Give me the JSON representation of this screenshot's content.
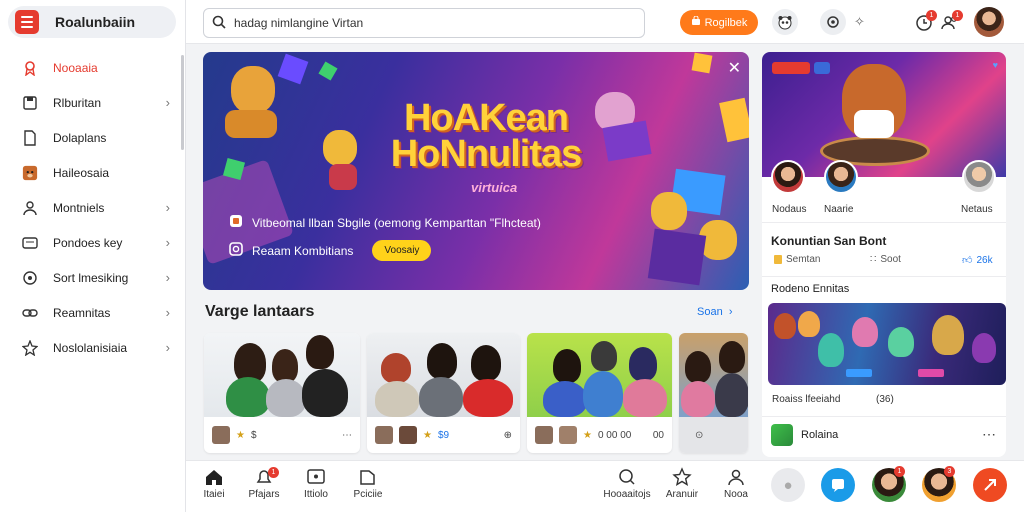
{
  "sidebar": {
    "brand": "Roalunbaiin",
    "items": [
      {
        "label": "Nooaaia",
        "icon": "ribbon-icon",
        "active": true,
        "chevron": false
      },
      {
        "label": "Rlburitan",
        "icon": "save-icon",
        "active": false,
        "chevron": true
      },
      {
        "label": "Dolaplans",
        "icon": "document-icon",
        "active": false,
        "chevron": false
      },
      {
        "label": "Haileosaia",
        "icon": "bear-icon",
        "active": false,
        "chevron": false
      },
      {
        "label": "Montniels",
        "icon": "user-icon",
        "active": false,
        "chevron": true
      },
      {
        "label": "Pondoes key",
        "icon": "card-icon",
        "active": false,
        "chevron": true
      },
      {
        "label": "Sort lmesiking",
        "icon": "globe-icon",
        "active": false,
        "chevron": true
      },
      {
        "label": "Reamnitas",
        "icon": "link-icon",
        "active": false,
        "chevron": true
      },
      {
        "label": "Noslolanisiaia",
        "icon": "star-icon",
        "active": false,
        "chevron": true
      }
    ]
  },
  "topbar": {
    "search_value": "hadag nimlangine Virtan",
    "primary_button": "Rogilbek",
    "notif_badge_1": "1",
    "notif_badge_2": "1"
  },
  "hero": {
    "title_line1": "HoAKean",
    "title_line2": "HoNnulitas",
    "subtitle": "virtuica",
    "description": "Vitbeomal llban Sbgile (oemong Kemparttan \"Flhcteat)",
    "cta_label": "Reaam Kombitians",
    "cta_button": "Voosaiy"
  },
  "section": {
    "title": "Varge lantaars",
    "see_all": "Soan"
  },
  "cards": [
    {
      "meta_text": "$",
      "menu": "⋯"
    },
    {
      "meta_text": "$9",
      "menu": "⊕"
    },
    {
      "meta_text": "0 00 00",
      "menu": "00"
    },
    {
      "meta_text": "",
      "menu": "⊙"
    }
  ],
  "bottom_nav": [
    {
      "label": "Itaiei",
      "icon": "home-icon"
    },
    {
      "label": "Pfajars",
      "icon": "bell-icon",
      "badge": "1"
    },
    {
      "label": "Ittiolo",
      "icon": "message-icon"
    },
    {
      "label": "Pciciie",
      "icon": "folder-icon"
    },
    {
      "label": "Hooaaitojs",
      "icon": "search-icon"
    },
    {
      "label": "Aranuir",
      "icon": "star-icon"
    },
    {
      "label": "Nooa",
      "icon": "profile-icon"
    }
  ],
  "bottom_badges": [
    "1",
    "3"
  ],
  "right_panel": {
    "tag1": "",
    "tag2": "",
    "people": [
      "Nodaus",
      "Naarie",
      "Netaus"
    ],
    "title": "Konuntian San Bont",
    "stat1": "Semtan",
    "stat2": "Soot",
    "stat3": "26k",
    "subheading": "Rodeno Ennitas",
    "caption_left": "Roaiss lfeeiahd",
    "caption_right": "(36)",
    "footer_label": "Rolaina",
    "footer_menu": "⋯"
  },
  "colors": {
    "accent": "#e53b2f",
    "orange": "#ff7a1a",
    "link": "#1a73e8",
    "cta": "#ffd21a"
  }
}
